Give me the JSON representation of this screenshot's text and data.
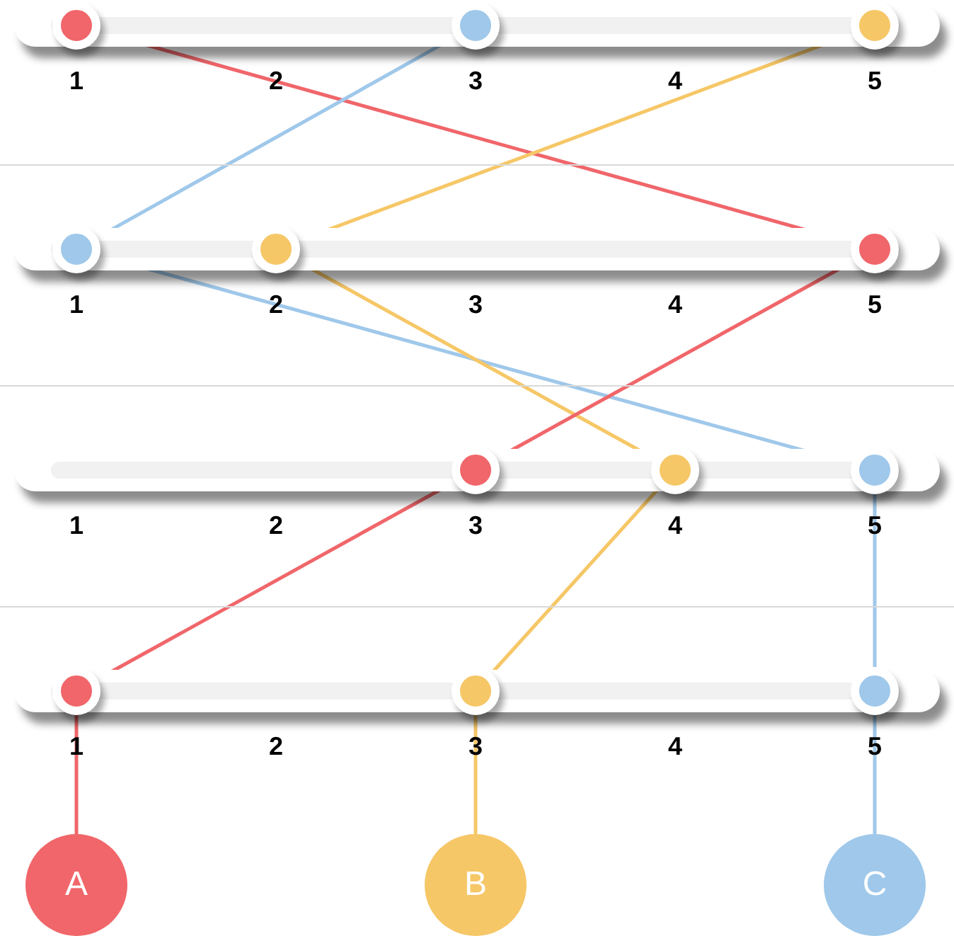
{
  "rows": [
    {
      "ticks": [
        "1",
        "2",
        "3",
        "4",
        "5"
      ],
      "thumbs": [
        {
          "color": "#f0666a",
          "level": 0
        },
        {
          "color": "#9fc8ea",
          "level": 0.5
        },
        {
          "color": "#f6c767",
          "level": 1
        }
      ]
    },
    {
      "ticks": [
        "1",
        "2",
        "3",
        "4",
        "5"
      ],
      "thumbs": [
        {
          "color": "#9fc8ea",
          "level": 0
        },
        {
          "color": "#f6c767",
          "level": 0.25
        },
        {
          "color": "#f0666a",
          "level": 1
        }
      ]
    },
    {
      "ticks": [
        "1",
        "2",
        "3",
        "4",
        "5"
      ],
      "thumbs": [
        {
          "color": "#f0666a",
          "level": 0.5
        },
        {
          "color": "#f6c767",
          "level": 0.75
        },
        {
          "color": "#9fc8ea",
          "level": 1
        }
      ]
    },
    {
      "ticks": [
        "1",
        "2",
        "3",
        "4",
        "5"
      ],
      "thumbs": [
        {
          "color": "#f0666a",
          "level": 0
        },
        {
          "color": "#f6c767",
          "level": 0.5
        },
        {
          "color": "#9fc8ea",
          "level": 1
        }
      ]
    }
  ],
  "nodes": [
    {
      "label": "A",
      "color": "#f0666a"
    },
    {
      "label": "B",
      "color": "#f6c767"
    },
    {
      "label": "C",
      "color": "#9fc8ea"
    }
  ]
}
